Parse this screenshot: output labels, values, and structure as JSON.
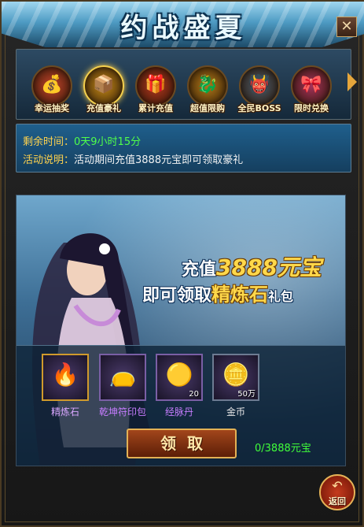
{
  "header": {
    "title": "约战盛夏",
    "close_label": "✕"
  },
  "tabs": [
    {
      "label": "幸运抽奖",
      "icon": "treasure-sack-icon",
      "glyph": "💰",
      "color": "#c4432a",
      "active": false
    },
    {
      "label": "充值豪礼",
      "icon": "gold-chest-icon",
      "glyph": "📦",
      "color": "#c58a17",
      "active": true
    },
    {
      "label": "累计充值",
      "icon": "red-giftbox-icon",
      "glyph": "🎁",
      "color": "#b5361e",
      "active": false
    },
    {
      "label": "超值限购",
      "icon": "golden-beast-icon",
      "glyph": "🐉",
      "color": "#b37a18",
      "active": false
    },
    {
      "label": "全民BOSS",
      "icon": "boss-monster-icon",
      "glyph": "👹",
      "color": "#4a5a6a",
      "active": false
    },
    {
      "label": "限时兑换",
      "icon": "pink-giftbox-icon",
      "glyph": "🎀",
      "color": "#a4325a",
      "active": false
    }
  ],
  "info": {
    "time_key": "剩余时间：",
    "time_value": "0天9小时15分",
    "desc_key": "活动说明：",
    "desc_value": "活动期间充值3888元宝即可领取豪礼"
  },
  "promo": {
    "line1_a": "充值",
    "line1_b": "3888元宝",
    "line2_a": "即可领取",
    "line2_b": "精炼石",
    "line2_c": "礼包"
  },
  "rewards": [
    {
      "name": "精炼石",
      "icon": "refining-stone-icon",
      "symbol": "🔥",
      "count": "",
      "name_color": "#d9a6ff",
      "frame": "gold"
    },
    {
      "name": "乾坤符印包",
      "icon": "seal-bag-icon",
      "symbol": "👝",
      "count": "",
      "name_color": "#c77dff",
      "frame": "purple"
    },
    {
      "name": "经脉丹",
      "icon": "meridian-pill-icon",
      "symbol": "🟡",
      "count": "20",
      "name_color": "#c77dff",
      "frame": "purple"
    },
    {
      "name": "金币",
      "icon": "gold-coins-icon",
      "symbol": "🪙",
      "count": "50万",
      "name_color": "#e6e6e6",
      "frame": "blue"
    }
  ],
  "claim_button": "领取",
  "progress": {
    "text": "0/3888元宝",
    "current": 0,
    "target": 3888
  },
  "back_button": {
    "label": "返回",
    "icon_glyph": "↶"
  }
}
